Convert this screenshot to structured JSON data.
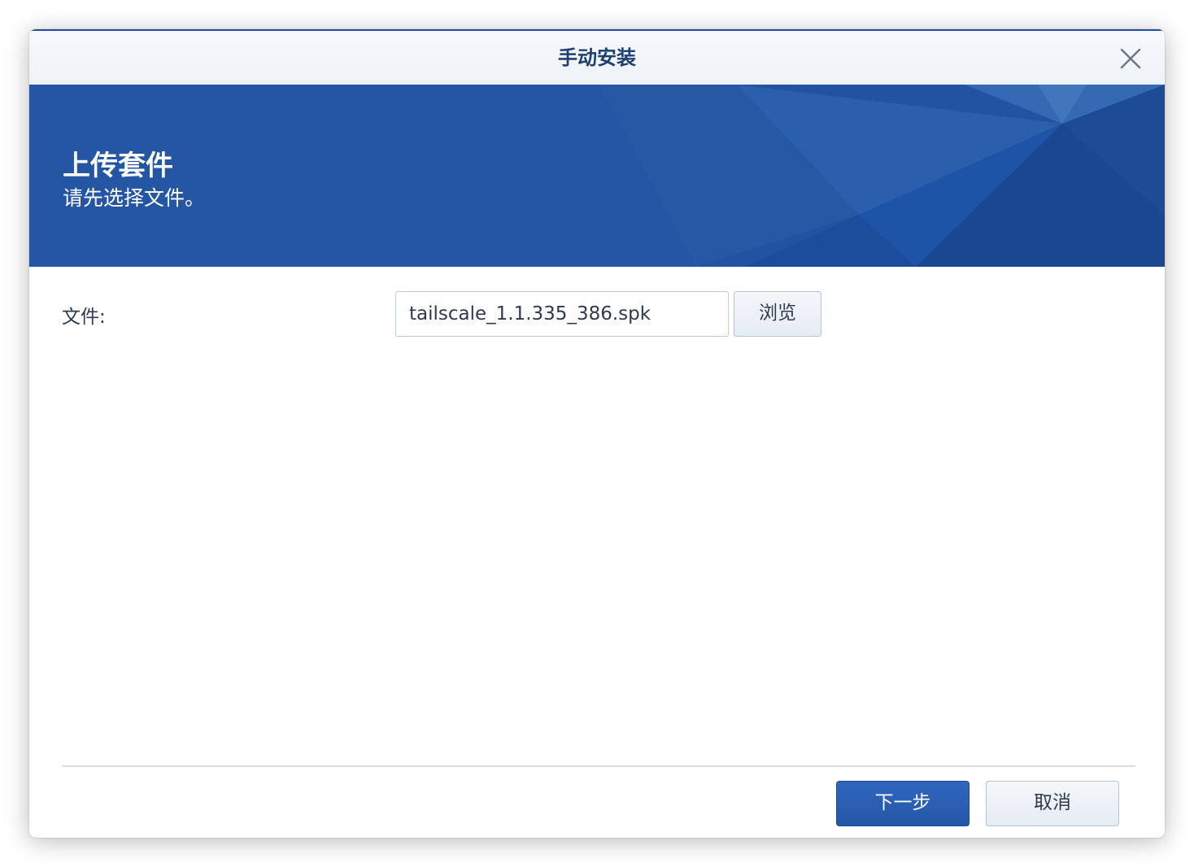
{
  "dialog": {
    "title": "手动安装",
    "close_icon": "close-icon"
  },
  "banner": {
    "title": "上传套件",
    "subtitle": "请先选择文件。",
    "background_color": "#2556a3"
  },
  "form": {
    "file_label": "文件:",
    "file_value": "tailscale_1.1.335_386.spk",
    "browse_label": "浏览"
  },
  "footer": {
    "next_label": "下一步",
    "cancel_label": "取消"
  },
  "colors": {
    "title_text": "#1e3f72",
    "primary_button": "#2457a8",
    "text": "#2f3b4c"
  }
}
